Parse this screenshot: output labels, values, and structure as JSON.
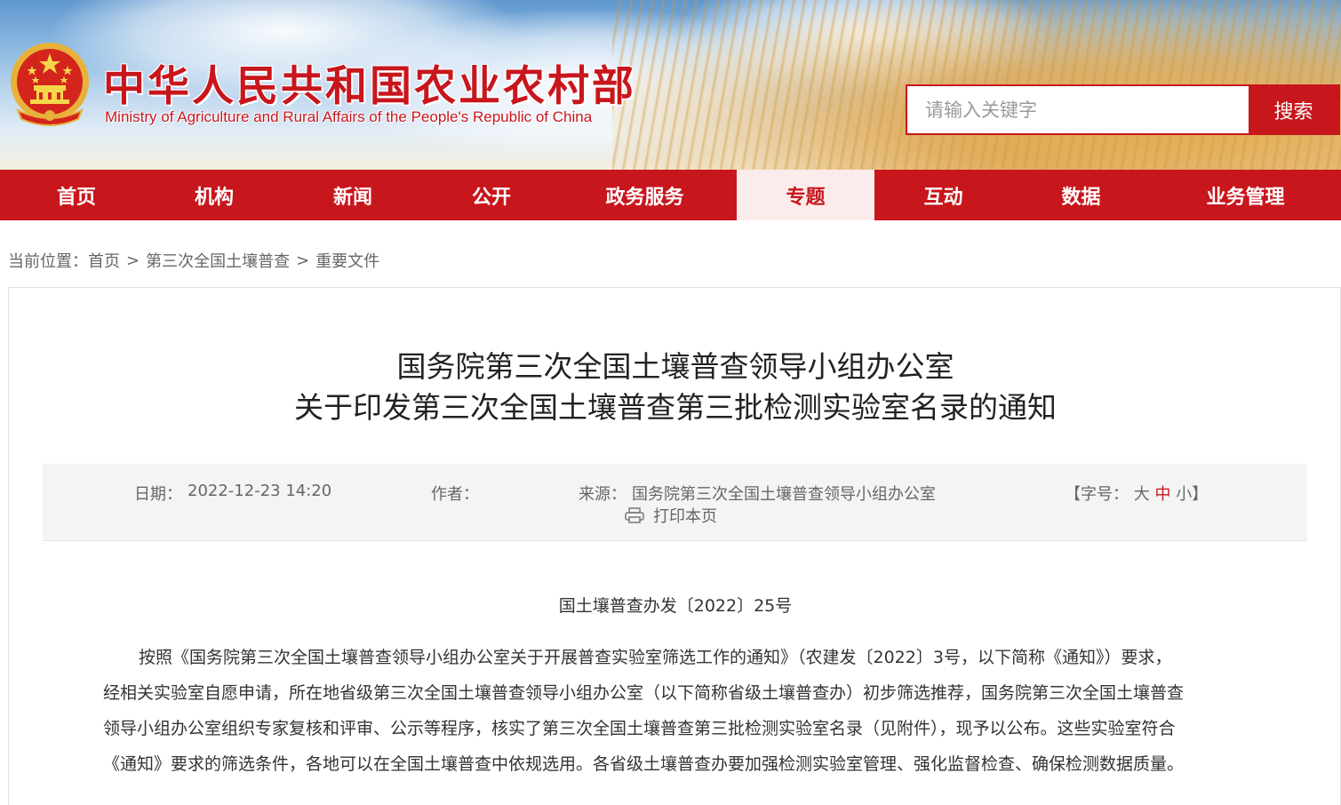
{
  "header": {
    "site_title": "中华人民共和国农业农村部",
    "site_subtitle": "Ministry of Agriculture and Rural Affairs of the People's Republic of China",
    "search_placeholder": "请输入关键字",
    "search_button": "搜索",
    "brand_color": "#c8161d"
  },
  "nav": {
    "items": [
      {
        "label": "首页",
        "active": false
      },
      {
        "label": "机构",
        "active": false
      },
      {
        "label": "新闻",
        "active": false
      },
      {
        "label": "公开",
        "active": false
      },
      {
        "label": "政务服务",
        "active": false
      },
      {
        "label": "专题",
        "active": true
      },
      {
        "label": "互动",
        "active": false
      },
      {
        "label": "数据",
        "active": false
      },
      {
        "label": "业务管理",
        "active": false
      }
    ]
  },
  "breadcrumb": {
    "prefix": "当前位置：",
    "items": [
      "首页",
      "第三次全国土壤普查",
      "重要文件"
    ],
    "separator": ">"
  },
  "article": {
    "title_line1": "国务院第三次全国土壤普查领导小组办公室",
    "title_line2": "关于印发第三次全国土壤普查第三批检测实验室名录的通知",
    "meta": {
      "date_label": "日期：",
      "date_value": "2022-12-23 14:20",
      "author_label": "作者：",
      "author_value": "",
      "source_label": "来源：",
      "source_value": "国务院第三次全国土壤普查领导小组办公室",
      "font_size_label": "【字号：",
      "font_size_large": "大",
      "font_size_medium": "中",
      "font_size_small": "小",
      "font_size_end": "】",
      "print_label": "打印本页"
    },
    "doc_number": "国土壤普查办发〔2022〕25号",
    "body_lines": [
      "按照《国务院第三次全国土壤普查领导小组办公室关于开展普查实验室筛选工作的通知》（农建发〔2022〕3号，以下简称《通知》）要求，",
      "经相关实验室自愿申请，所在地省级第三次全国土壤普查领导小组办公室（以下简称省级土壤普查办）初步筛选推荐，国务院第三次全国土壤普查",
      "领导小组办公室组织专家复核和评审、公示等程序，核实了第三次全国土壤普查第三批检测实验室名录（见附件），现予以公布。这些实验室符合",
      "《通知》要求的筛选条件，各地可以在全国土壤普查中依规选用。各省级土壤普查办要加强检测实验室管理、强化监督检查、确保检测数据质量。"
    ]
  }
}
